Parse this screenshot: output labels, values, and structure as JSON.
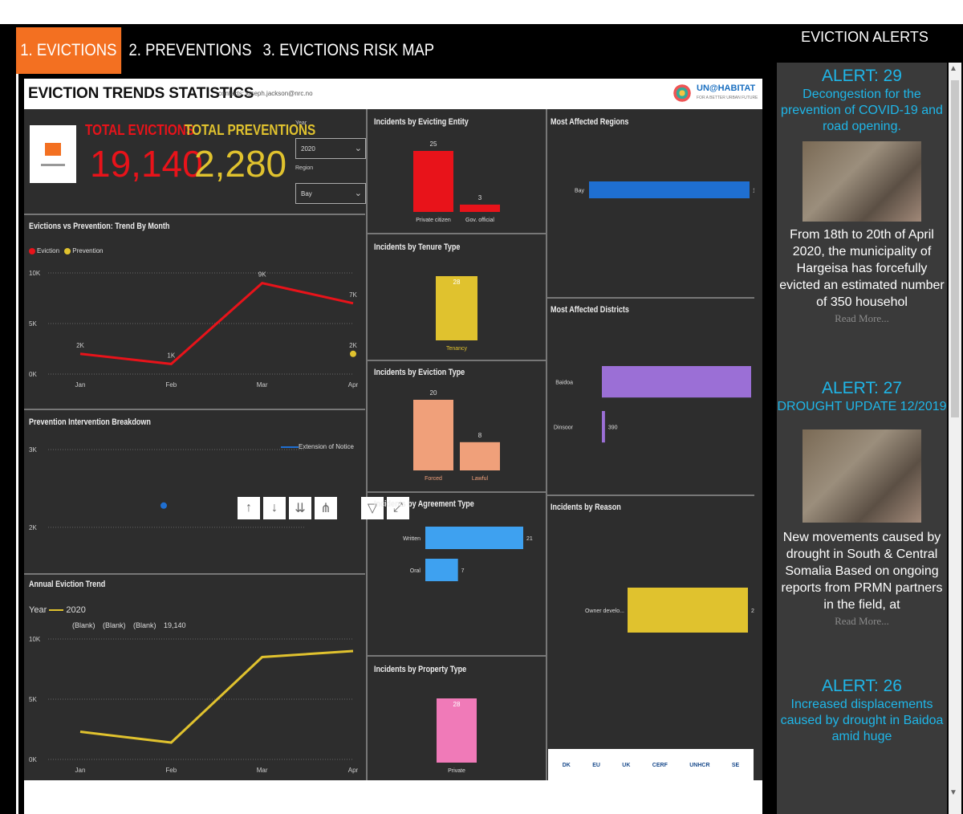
{
  "tabs": [
    {
      "label": "1. EVICTIONS",
      "active": true
    },
    {
      "label": "2. PREVENTIONS",
      "active": false
    },
    {
      "label": "3. EVICTIONS RISK MAP",
      "active": false
    }
  ],
  "alerts_panel": {
    "title": "EVICTION ALERTS",
    "alerts": [
      {
        "heading": "ALERT: 29",
        "subtitle": "Decongestion for the prevention of COVID-19 and road opening.",
        "body": "From 18th to 20th of April 2020, the municipality of Hargeisa has forcefully evicted an estimated number of 350 househol",
        "link": "Read More..."
      },
      {
        "heading": "ALERT: 27",
        "subtitle": "DROUGHT UPDATE 12/2019",
        "body": "New movements caused by drought in South & Central Somalia Based on ongoing reports from PRMN partners in the field, at",
        "link": "Read More..."
      },
      {
        "heading": "ALERT: 26",
        "subtitle": "Increased displacements caused by drought in Baidoa amid huge",
        "body": "",
        "link": ""
      }
    ]
  },
  "report": {
    "title": "EVICTION TRENDS STATISTICS",
    "contact": "contacts: joseph.jackson@nrc.no",
    "partner_logo_text": "UN@HABITAT",
    "partner_logo_sub": "FOR A BETTER URBAN FUTURE",
    "kpis": {
      "total_evictions_label": "TOTAL EVICTIONS",
      "total_evictions_value": "19,140",
      "total_preventions_label": "TOTAL PREVENTIONS",
      "total_preventions_value": "2,280"
    },
    "slicers": {
      "year_label": "Year",
      "year_value": "2020",
      "region_label": "Region",
      "region_value": "Bay"
    },
    "colors": {
      "eviction": "#e8131a",
      "prevention": "#e0c22e",
      "blue": "#1f6fd1",
      "purple": "#9b6fd6",
      "salmon": "#f0a07a",
      "lightblue": "#3ea1f0",
      "pink": "#f07ab8"
    },
    "toolbar_icons": [
      "arrow-up-icon",
      "arrow-down-icon",
      "double-arrow-down-icon",
      "expand-hierarchy-icon",
      "filter-icon",
      "focus-mode-icon"
    ],
    "footer_logos": [
      "DK",
      "EU",
      "UK",
      "CERF",
      "UNHCR",
      "SE"
    ]
  },
  "chart_data": [
    {
      "type": "line",
      "title": "Evictions vs Prevention: Trend By Month",
      "categories": [
        "Jan",
        "Feb",
        "Mar",
        "Apr"
      ],
      "series": [
        {
          "name": "Eviction",
          "values": [
            2000,
            1000,
            9000,
            7000
          ],
          "labels": [
            "2K",
            "1K",
            "9K",
            "7K"
          ]
        },
        {
          "name": "Prevention",
          "values": [
            null,
            null,
            null,
            2000
          ],
          "labels": [
            "",
            "",
            "",
            "2K"
          ]
        }
      ],
      "yticks": [
        "10K",
        "5K",
        "0K"
      ],
      "ylim": [
        0,
        10000
      ]
    },
    {
      "type": "scatter",
      "title": "Prevention Intervention Breakdown",
      "legend": [
        "Extension of Notice"
      ],
      "x": [
        "Bay"
      ],
      "y": [
        2280
      ],
      "yticks": [
        "3K",
        "2K"
      ],
      "ylim": [
        1700,
        3000
      ]
    },
    {
      "type": "line",
      "title": "Annual Eviction Trend",
      "legend_title": "Year",
      "categories": [
        "Jan",
        "Feb",
        "Mar",
        "Apr"
      ],
      "series": [
        {
          "name": "2020",
          "values": [
            2300,
            1400,
            8500,
            9000
          ]
        }
      ],
      "top_labels": [
        "(Blank)",
        "(Blank)",
        "(Blank)",
        "19,140"
      ],
      "yticks": [
        "10K",
        "5K",
        "0K"
      ],
      "ylim": [
        0,
        10000
      ]
    },
    {
      "type": "bar",
      "title": "Incidents by Evicting Entity",
      "categories": [
        "Private citizen",
        "Gov. official"
      ],
      "values": [
        25,
        3
      ]
    },
    {
      "type": "bar",
      "title": "Incidents by Tenure Type",
      "categories": [
        "Tenancy"
      ],
      "values": [
        28
      ]
    },
    {
      "type": "bar",
      "title": "Incidents by Eviction Type",
      "categories": [
        "Forced",
        "Lawful"
      ],
      "values": [
        20,
        8
      ]
    },
    {
      "type": "bar",
      "orientation": "horizontal",
      "title": "Incidents by Agreement Type",
      "categories": [
        "Written",
        "Oral"
      ],
      "values": [
        21,
        7
      ]
    },
    {
      "type": "bar",
      "title": "Incidents by Property Type",
      "categories": [
        "Private"
      ],
      "values": [
        28
      ]
    },
    {
      "type": "bar",
      "orientation": "horizontal",
      "title": "Most Affected Regions",
      "categories": [
        "Bay"
      ],
      "values": [
        19140
      ],
      "labels": [
        "19,140"
      ]
    },
    {
      "type": "bar",
      "orientation": "horizontal",
      "title": "Most Affected Districts",
      "categories": [
        "Baidoa",
        "Dinsoor"
      ],
      "values": [
        18750,
        390
      ],
      "labels": [
        "18,750",
        "390"
      ]
    },
    {
      "type": "bar",
      "orientation": "horizontal",
      "title": "Incidents by Reason",
      "categories": [
        "Owner develo..."
      ],
      "values": [
        28
      ]
    }
  ]
}
